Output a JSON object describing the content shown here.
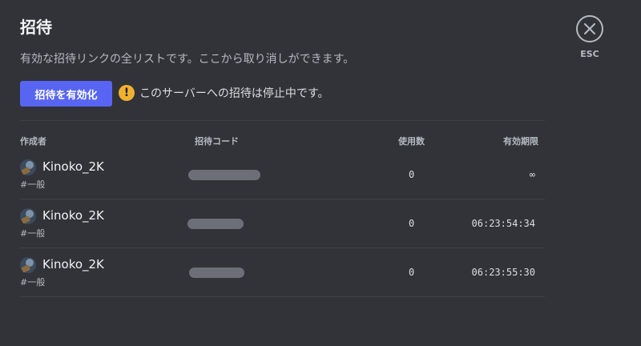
{
  "header": {
    "title": "招待",
    "description": "有効な招待リンクの全リストです。ここから取り消しができます。"
  },
  "actions": {
    "enable_label": "招待を有効化",
    "warning_text": "このサーバーへの招待は停止中です。",
    "warning_icon": "exclamation-icon"
  },
  "close": {
    "icon": "close-icon",
    "esc_label": "ESC"
  },
  "table": {
    "headers": {
      "creator": "作成者",
      "code": "招待コード",
      "uses": "使用数",
      "expires": "有効期限"
    },
    "rows": [
      {
        "username": "Kinoko_2K",
        "channel": "#一般",
        "uses": "0",
        "expires": "∞"
      },
      {
        "username": "Kinoko_2K",
        "channel": "#一般",
        "uses": "0",
        "expires": "06:23:54:34"
      },
      {
        "username": "Kinoko_2K",
        "channel": "#一般",
        "uses": "0",
        "expires": "06:23:55:30"
      }
    ]
  },
  "colors": {
    "background": "#313338",
    "accent": "#5865f2",
    "warning": "#f0b132",
    "redacted": "#6d6f78"
  }
}
